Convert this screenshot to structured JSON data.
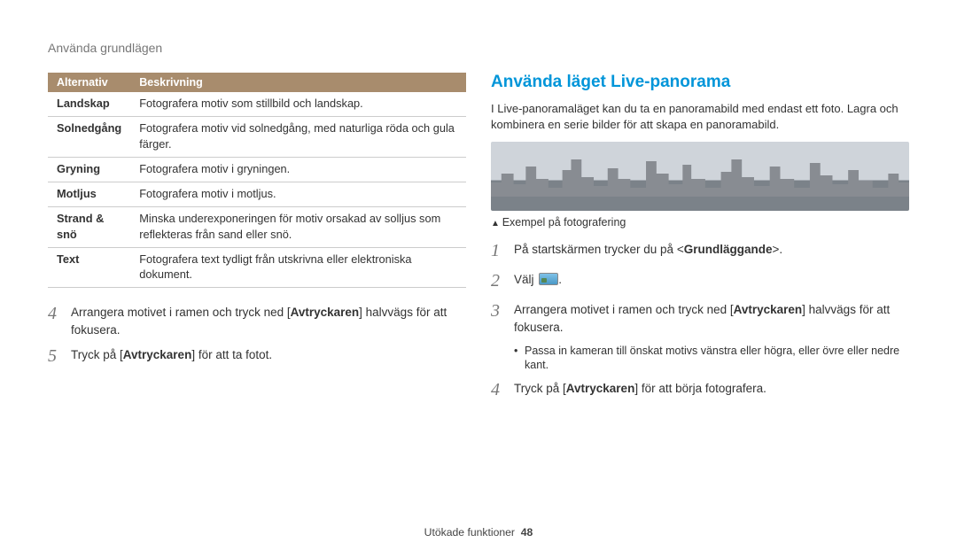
{
  "header": {
    "breadcrumb": "Använda grundlägen"
  },
  "table": {
    "headers": [
      "Alternativ",
      "Beskrivning"
    ],
    "rows": [
      {
        "opt": "Landskap",
        "desc": "Fotografera motiv som stillbild och landskap."
      },
      {
        "opt": "Solnedgång",
        "desc": "Fotografera motiv vid solnedgång, med naturliga röda och gula färger."
      },
      {
        "opt": "Gryning",
        "desc": "Fotografera motiv i gryningen."
      },
      {
        "opt": "Motljus",
        "desc": "Fotografera motiv i motljus."
      },
      {
        "opt": "Strand & snö",
        "desc": "Minska underexponeringen för motiv orsakad av solljus som reflekteras från sand eller snö."
      },
      {
        "opt": "Text",
        "desc": "Fotografera text tydligt från utskrivna eller elektroniska dokument."
      }
    ]
  },
  "left_steps": {
    "s4": {
      "pre": "Arrangera motivet i ramen och tryck ned [",
      "bold": "Avtryckaren",
      "post": "] halvvägs för att fokusera."
    },
    "s5": {
      "pre": "Tryck på [",
      "bold": "Avtryckaren",
      "post": "] för att ta fotot."
    }
  },
  "right": {
    "title": "Använda läget Live-panorama",
    "intro": "I Live-panoramaläget kan du ta en panoramabild med endast ett foto. Lagra och kombinera en serie bilder för att skapa en panoramabild.",
    "caption": "Exempel på fotografering",
    "steps": {
      "s1": {
        "pre": "På startskärmen trycker du på <",
        "bold": "Grundläggande",
        "post": ">."
      },
      "s2": {
        "text": "Välj"
      },
      "s3": {
        "pre": "Arrangera motivet i ramen och tryck ned [",
        "bold": "Avtryckaren",
        "post": "] halvvägs för att fokusera."
      },
      "s3_sub": "Passa in kameran till önskat motivs vänstra eller högra, eller övre eller nedre kant.",
      "s4": {
        "pre": "Tryck på [",
        "bold": "Avtryckaren",
        "post": "] för att börja fotografera."
      }
    }
  },
  "footer": {
    "section": "Utökade funktioner",
    "page": "48"
  },
  "nums": {
    "n1": "1",
    "n2": "2",
    "n3": "3",
    "n4": "4",
    "n5": "5"
  }
}
